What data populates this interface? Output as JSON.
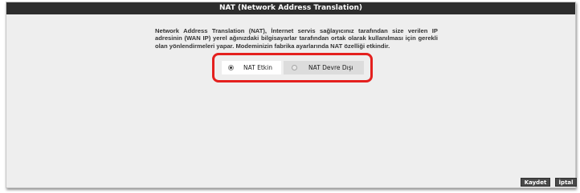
{
  "header": {
    "title": "NAT (Network Address Translation)"
  },
  "content": {
    "description": "Network Address Translation (NAT), İnternet servis sağlayıcınız tarafından size verilen IP adresinin (WAN IP) yerel ağınızdaki bilgisayarlar tarafından ortak olarak kullanılması için gerekli olan yönlendirmeleri yapar. Modeminizin fabrika ayarlarında NAT özelliği etkindir."
  },
  "nat_options": {
    "selected": "enabled",
    "enabled_label": "NAT Etkin",
    "disabled_label": "NAT Devre Dışı"
  },
  "footer": {
    "save_label": "Kaydet",
    "cancel_label": "İptal"
  },
  "colors": {
    "title_bar": "#2d2d2d",
    "panel_background": "#eeeeee",
    "highlight_border": "#e4201e",
    "button_background": "#4a4a4a"
  }
}
